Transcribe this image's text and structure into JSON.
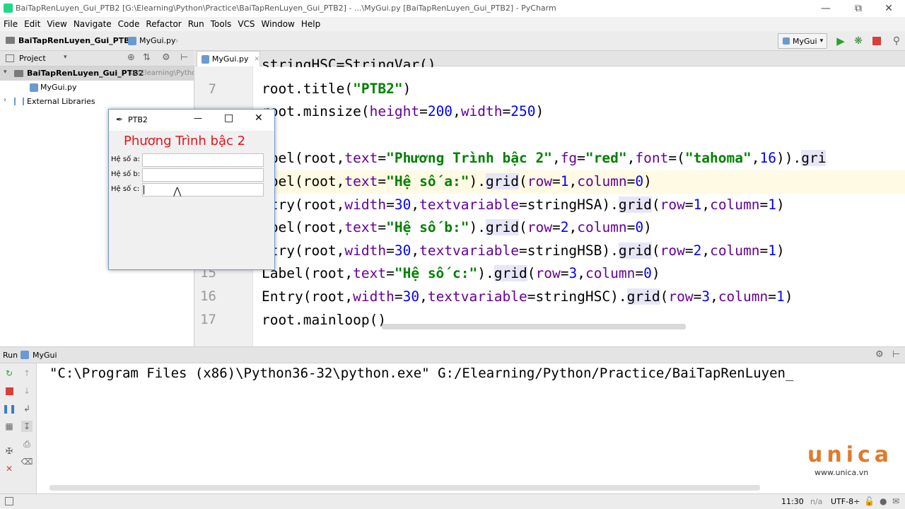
{
  "window": {
    "title": "BaiTapRenLuyen_Gui_PTB2 [G:\\Elearning\\Python\\Practice\\BaiTapRenLuyen_Gui_PTB2] - ...\\MyGui.py [BaiTapRenLuyen_Gui_PTB2] - PyCharm"
  },
  "menu": [
    "File",
    "Edit",
    "View",
    "Navigate",
    "Code",
    "Refactor",
    "Run",
    "Tools",
    "VCS",
    "Window",
    "Help"
  ],
  "breadcrumb": {
    "project": "BaiTapRenLuyen_Gui_PTB2",
    "file": "MyGui.py"
  },
  "toolbar": {
    "run_config": "MyGui"
  },
  "project_panel": {
    "header": "Project",
    "root": "BaiTapRenLuyen_Gui_PTB2",
    "root_path": "G:\\Elearning\\Pytho",
    "file": "MyGui.py",
    "ext_libs": "External Libraries"
  },
  "editor": {
    "tab": "MyGui.py",
    "line_numbers": [
      "7",
      "15",
      "16",
      "17"
    ],
    "lines": {
      "l6": "stringHSC=StringVar()",
      "l7_a": "root.title(",
      "l7_s": "\"PTB2\"",
      "l7_b": ")",
      "l8_a": "root.minsize(",
      "l8_p1": "height",
      "l8_e1": "=",
      "l8_n1": "200",
      "l8_c": ",",
      "l8_p2": "width",
      "l8_e2": "=",
      "l8_n2": "250",
      "l8_b": ")",
      "l10_a": "abel(root,",
      "l10_p1": "text",
      "l10_e1": "=",
      "l10_s1": "\"Phương Trình bậc 2\"",
      "l10_c1": ",",
      "l10_p2": "fg",
      "l10_e2": "=",
      "l10_s2": "\"red\"",
      "l10_c2": ",",
      "l10_p3": "font",
      "l10_e3": "=(",
      "l10_s3": "\"tahoma\"",
      "l10_c3": ",",
      "l10_n": "16",
      "l10_b": ")).",
      "l10_g": "gri",
      "l11_a": "abel(root,",
      "l11_p": "text",
      "l11_e": "=",
      "l11_s": "\"Hệ số a:\"",
      "l11_b": ").",
      "l11_g": "grid",
      "l11_c": "(",
      "l11_p2": "row",
      "l11_e2": "=",
      "l11_n2": "1",
      "l11_k": ",",
      "l11_p3": "column",
      "l11_e3": "=",
      "l11_n3": "0",
      "l11_z": ")",
      "l12_a": "ntry(root,",
      "l12_p1": "width",
      "l12_e1": "=",
      "l12_n1": "30",
      "l12_c1": ",",
      "l12_p2": "textvariable",
      "l12_e2": "=stringHSA).",
      "l12_g": "grid",
      "l12_c": "(",
      "l12_p3": "row",
      "l12_e3": "=",
      "l12_n3": "1",
      "l12_k": ",",
      "l12_p4": "column",
      "l12_e4": "=",
      "l12_n4": "1",
      "l12_z": ")",
      "l13_a": "abel(root,",
      "l13_p": "text",
      "l13_e": "=",
      "l13_s": "\"Hệ số b:\"",
      "l13_b": ").",
      "l13_g": "grid",
      "l13_c": "(",
      "l13_p2": "row",
      "l13_e2": "=",
      "l13_n2": "2",
      "l13_k": ",",
      "l13_p3": "column",
      "l13_e3": "=",
      "l13_n3": "0",
      "l13_z": ")",
      "l14_a": "ntry(root,",
      "l14_p1": "width",
      "l14_e1": "=",
      "l14_n1": "30",
      "l14_c1": ",",
      "l14_p2": "textvariable",
      "l14_e2": "=stringHSB).",
      "l14_g": "grid",
      "l14_c": "(",
      "l14_p3": "row",
      "l14_e3": "=",
      "l14_n3": "2",
      "l14_k": ",",
      "l14_p4": "column",
      "l14_e4": "=",
      "l14_n4": "1",
      "l14_z": ")",
      "l15_a": "Label(root,",
      "l15_p": "text",
      "l15_e": "=",
      "l15_s": "\"Hệ số c:\"",
      "l15_b": ").",
      "l15_g": "grid",
      "l15_c": "(",
      "l15_p2": "row",
      "l15_e2": "=",
      "l15_n2": "3",
      "l15_k": ",",
      "l15_p3": "column",
      "l15_e3": "=",
      "l15_n3": "0",
      "l15_z": ")",
      "l16_a": "Entry(root,",
      "l16_p1": "width",
      "l16_e1": "=",
      "l16_n1": "30",
      "l16_c1": ",",
      "l16_p2": "textvariable",
      "l16_e2": "=stringHSC).",
      "l16_g": "grid",
      "l16_c": "(",
      "l16_p3": "row",
      "l16_e3": "=",
      "l16_n3": "3",
      "l16_k": ",",
      "l16_p4": "column",
      "l16_e4": "=",
      "l16_n4": "1",
      "l16_z": ")",
      "l17": "root.mainloop()"
    }
  },
  "tk_window": {
    "title": "PTB2",
    "heading": "Phương Trình bậc 2",
    "heading_color": "#e8121b",
    "label_a": "Hệ số a:",
    "label_b": "Hệ số b:",
    "label_c": "Hệ số c:"
  },
  "run_panel": {
    "label": "Run",
    "config": "MyGui",
    "command": "\"C:\\Program Files (x86)\\Python36-32\\python.exe\" G:/Elearning/Python/Practice/BaiTapRenLuyen_"
  },
  "status": {
    "position": "11:30",
    "na": "n/a",
    "encoding": "UTF-8÷"
  },
  "watermark": {
    "brand": "unica",
    "url": "www.unica.vn",
    "brand_color": "#e07a2b",
    "brand_color2": "#2a9fd8"
  }
}
